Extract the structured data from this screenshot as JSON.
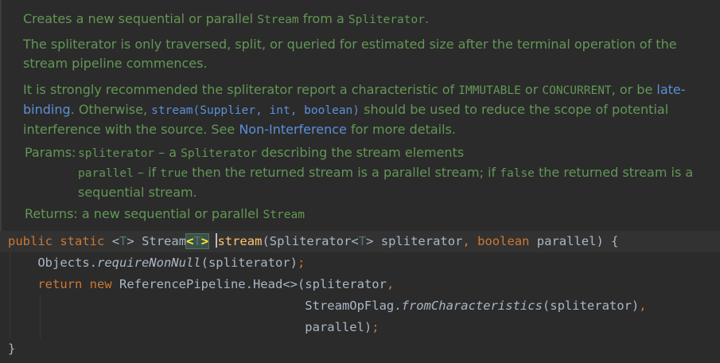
{
  "javadoc": {
    "p1": "Creates a new sequential or parallel ",
    "p1_code1": "Stream",
    "p1_mid": " from a ",
    "p1_code2": "Spliterator",
    "p1_end": ".",
    "p2": "The spliterator is only traversed, split, or queried for estimated size after the terminal operation of the stream pipeline commences.",
    "p3_a": "It is strongly recommended the spliterator report a characteristic of ",
    "p3_code1": "IMMUTABLE",
    "p3_b": " or ",
    "p3_code2": "CONCURRENT",
    "p3_c": ", or be ",
    "p3_link1": "late-binding",
    "p3_d": ". Otherwise, ",
    "p3_link2": "stream(Supplier, int, boolean)",
    "p3_e": " should be used to reduce the scope of potential interference with the source. See ",
    "p3_link3": "Non-Interference",
    "p3_f": " for more details.",
    "params_label": "Params:",
    "param1_name": "spliterator",
    "param1_a": " – a ",
    "param1_code": "Spliterator",
    "param1_b": " describing the stream elements",
    "param2_name": "parallel",
    "param2_a": " – if ",
    "param2_code1": "true",
    "param2_b": " then the returned stream is a parallel stream; if ",
    "param2_code2": "false",
    "param2_c": " the returned stream is a sequential stream.",
    "returns_label": "Returns:",
    "returns_a": " a new sequential or parallel ",
    "returns_code": "Stream"
  },
  "code": {
    "l1_public": "public",
    "l1_static": "static",
    "l1_lt": "<",
    "l1_T": "T",
    "l1_gt": ">",
    "l1_stream_type": "Stream",
    "l1_method": "stream",
    "l1_params": "(Spliterator<",
    "l1_params2": "> spliterator",
    "l1_comma": ",",
    "l1_boolean": "boolean",
    "l1_end": " parallel) {",
    "l2_obj": "Objects.",
    "l2_method": "requireNonNull",
    "l2_args": "(spliterator)",
    "l2_semi": ";",
    "l3_return": "return",
    "l3_new": "new",
    "l3_rest": " ReferencePipeline.Head<>(spliterator",
    "l3_comma": ",",
    "l4_obj": "StreamOpFlag.",
    "l4_method": "fromCharacteristics",
    "l4_args": "(spliterator)",
    "l4_comma": ",",
    "l5_arg": "parallel)",
    "l5_semi": ";",
    "l6_brace": "}"
  }
}
